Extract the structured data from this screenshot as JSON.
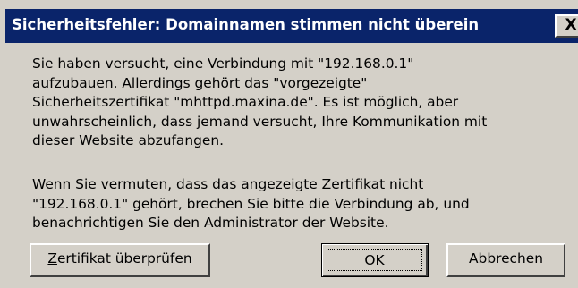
{
  "window": {
    "title": "Sicherheitsfehler: Domainnamen stimmen nicht überein",
    "close_label": "X"
  },
  "message": {
    "paragraph1": "Sie haben versucht, eine Verbindung mit \"192.168.0.1\"\naufzubauen. Allerdings gehört das \"vorgezeigte\"\nSicherheitszertifikat \"mhttpd.maxina.de\". Es ist möglich, aber\nunwahrscheinlich, dass jemand versucht, Ihre Kommunikation mit\ndieser Website abzufangen.",
    "paragraph2": "Wenn Sie vermuten, dass das angezeigte Zertifikat nicht\n\"192.168.0.1\" gehört, brechen Sie bitte die Verbindung ab, und\nbenachrichtigen Sie den Administrator der Website."
  },
  "buttons": {
    "verify_mnemonic": "Z",
    "verify_rest": "ertifikat überprüfen",
    "ok": "OK",
    "cancel": "Abbrechen"
  },
  "colors": {
    "titlebar": "#0a246a",
    "dialog_bg": "#d4d0c8"
  }
}
